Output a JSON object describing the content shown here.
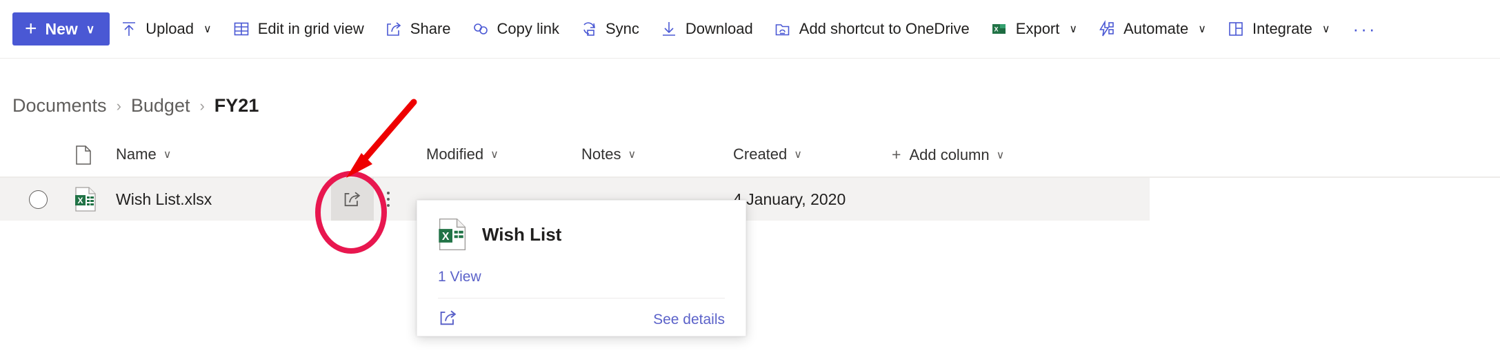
{
  "theme": {
    "accent_blue": "#4a58d4",
    "link_blue": "#5b62c9",
    "row_highlight": "#f3f2f1",
    "excel_green": "#217346",
    "annotation_pink": "#e8174f",
    "annotation_red": "#ee0000"
  },
  "commandbar": {
    "new_button": {
      "label": "New",
      "plus": "+",
      "chevron": "∨"
    },
    "items": [
      {
        "label": "Upload",
        "icon": "upload-icon",
        "chevron": true
      },
      {
        "label": "Edit in grid view",
        "icon": "grid-icon",
        "chevron": false
      },
      {
        "label": "Share",
        "icon": "share-icon",
        "chevron": false
      },
      {
        "label": "Copy link",
        "icon": "link-icon",
        "chevron": false
      },
      {
        "label": "Sync",
        "icon": "sync-icon",
        "chevron": false
      },
      {
        "label": "Download",
        "icon": "download-icon",
        "chevron": false
      },
      {
        "label": "Add shortcut to OneDrive",
        "icon": "add-shortcut-icon",
        "chevron": false
      },
      {
        "label": "Export",
        "icon": "excel-icon",
        "chevron": true
      },
      {
        "label": "Automate",
        "icon": "automate-icon",
        "chevron": true
      },
      {
        "label": "Integrate",
        "icon": "integrate-icon",
        "chevron": true
      }
    ],
    "overflow": "···"
  },
  "breadcrumb": {
    "separator": "›",
    "items": [
      {
        "label": "Documents",
        "current": false
      },
      {
        "label": "Budget",
        "current": false
      },
      {
        "label": "FY21",
        "current": true
      }
    ]
  },
  "list": {
    "columns": [
      {
        "label": "Name",
        "chevron": "∨",
        "plus": false
      },
      {
        "label": "Modified",
        "chevron": "∨",
        "plus": false
      },
      {
        "label": "Notes",
        "chevron": "∨",
        "plus": false
      },
      {
        "label": "Created",
        "chevron": "∨",
        "plus": false
      },
      {
        "label": "Add column",
        "chevron": "∨",
        "plus": true
      }
    ],
    "rows": [
      {
        "name": "Wish List.xlsx",
        "file_icon": "excel-file-icon",
        "modified": "",
        "notes": "",
        "created": "4 January, 2020",
        "selected": false
      }
    ]
  },
  "callout": {
    "file_icon": "excel-file-icon",
    "title": "Wish List",
    "views": "1 View",
    "share_icon": "share-icon",
    "see_details": "See details"
  },
  "annotation": {
    "ellipse_around": "row-share-button",
    "arrow_points_to": "row-share-button"
  }
}
